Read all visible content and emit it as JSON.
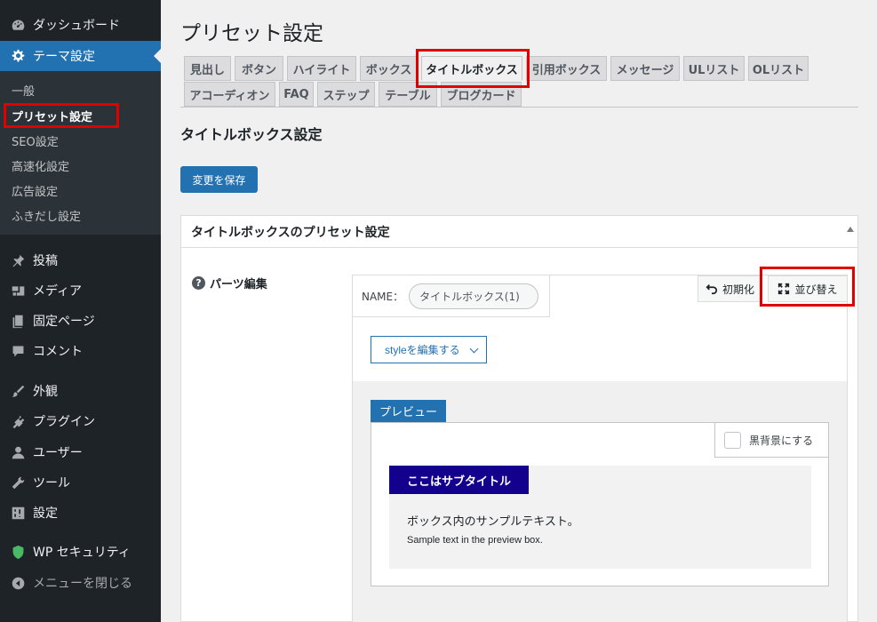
{
  "sidebar": {
    "items": [
      {
        "label": "ダッシュボード",
        "icon": "dashboard-icon"
      },
      {
        "label": "テーマ設定",
        "icon": "gear-icon"
      },
      {
        "label": "投稿",
        "icon": "pin-icon"
      },
      {
        "label": "メディア",
        "icon": "media-icon"
      },
      {
        "label": "固定ページ",
        "icon": "pages-icon"
      },
      {
        "label": "コメント",
        "icon": "comment-icon"
      },
      {
        "label": "外観",
        "icon": "brush-icon"
      },
      {
        "label": "プラグイン",
        "icon": "plugin-icon"
      },
      {
        "label": "ユーザー",
        "icon": "user-icon"
      },
      {
        "label": "ツール",
        "icon": "wrench-icon"
      },
      {
        "label": "設定",
        "icon": "settings-sliders-icon"
      },
      {
        "label": "WP セキュリティ",
        "icon": "shield-icon"
      },
      {
        "label": "メニューを閉じる",
        "icon": "collapse-arrow-icon"
      }
    ],
    "submenu": [
      "一般",
      "プリセット設定",
      "SEO設定",
      "高速化設定",
      "広告設定",
      "ふきだし設定"
    ]
  },
  "page": {
    "title": "プリセット設定",
    "tabs": [
      "見出し",
      "ボタン",
      "ハイライト",
      "ボックス",
      "タイトルボックス",
      "引用ボックス",
      "メッセージ",
      "ULリスト",
      "OLリスト",
      "アコーディオン",
      "FAQ",
      "ステップ",
      "テーブル",
      "ブログカード"
    ],
    "active_tab": "タイトルボックス",
    "section_title": "タイトルボックス設定",
    "save_label": "変更を保存"
  },
  "panel": {
    "header": "タイトルボックスのプリセット設定",
    "field_label": "パーツ編集",
    "help_glyph": "?",
    "name_label": "NAME：",
    "name_value": "タイトルボックス(1)",
    "reset_label": "初期化",
    "sort_label": "並び替え",
    "style_button": "styleを編集する",
    "preview_tab": "プレビュー",
    "dark_bg_label": "黒背景にする",
    "sample_title": "ここはサブタイトル",
    "sample_text_jp": "ボックス内のサンプルテキスト。",
    "sample_text_en": "Sample text in the preview box.",
    "sample_title_bg": "#13008c"
  },
  "colors": {
    "accent": "#2271b1",
    "highlight": "#e00000",
    "sidebar_bg": "#1d2327"
  }
}
